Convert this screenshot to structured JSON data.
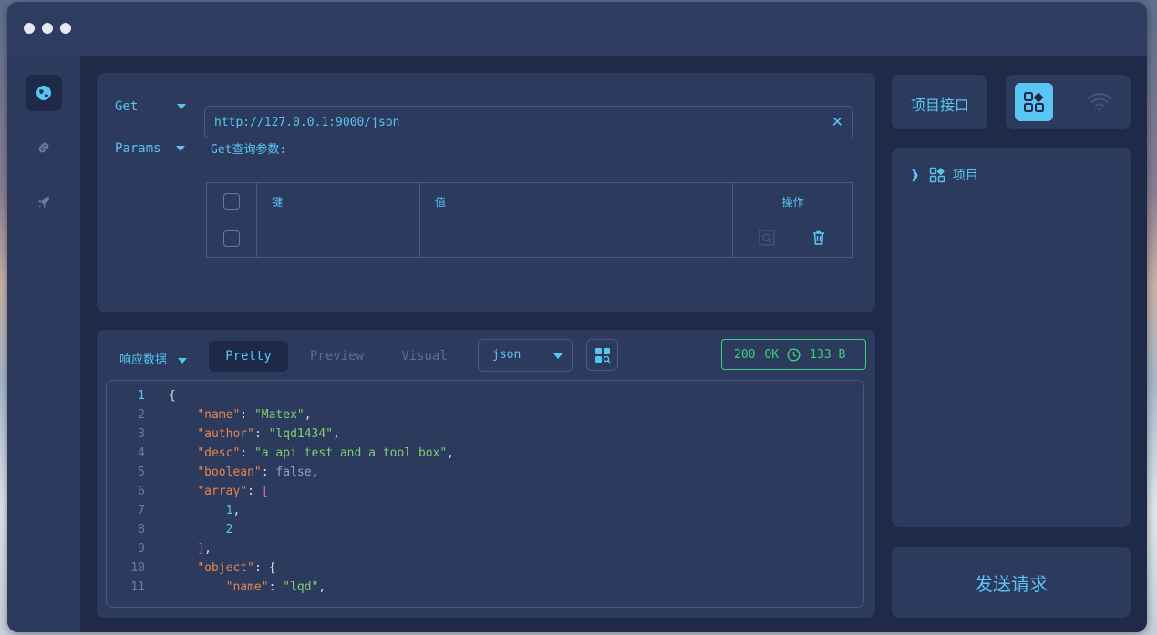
{
  "window": {
    "title_dots": [
      "close",
      "minimize",
      "maximize"
    ]
  },
  "sidebar": {
    "items": [
      {
        "icon": "globe-icon",
        "active": true
      },
      {
        "icon": "link-icon",
        "active": false
      },
      {
        "icon": "rocket-icon",
        "active": false
      }
    ]
  },
  "request": {
    "method": "Get",
    "url": "http://127.0.0.1:9000/json",
    "params_label": "Params",
    "params_title": "Get查询参数:",
    "table": {
      "headers": [
        "键",
        "值",
        "操作"
      ]
    }
  },
  "response": {
    "label": "响应数据",
    "tabs": [
      "Pretty",
      "Preview",
      "Visual"
    ],
    "active_tab": "Pretty",
    "format": "json",
    "status_code": "200",
    "status_text": "OK",
    "size": "133 B",
    "lines": [
      {
        "n": "1"
      },
      {
        "n": "2"
      },
      {
        "n": "3"
      },
      {
        "n": "4"
      },
      {
        "n": "5"
      },
      {
        "n": "6"
      },
      {
        "n": "7"
      },
      {
        "n": "8"
      },
      {
        "n": "9"
      },
      {
        "n": "10"
      },
      {
        "n": "11"
      }
    ],
    "code": {
      "l1": "{",
      "l2k": "\"name\"",
      "l2v": "\"Matex\"",
      "l3k": "\"author\"",
      "l3v": "\"lqd1434\"",
      "l4k": "\"desc\"",
      "l4v": "\"a api test and a tool box\"",
      "l5k": "\"boolean\"",
      "l5v": "false",
      "l6k": "\"array\"",
      "l6v": "[",
      "l7v": "1",
      "l8v": "2",
      "l9v": "]",
      "l10k": "\"object\"",
      "l10v": "{",
      "l11k": "\"name\"",
      "l11v": "\"lqd\""
    }
  },
  "right": {
    "project_tab": "项目接口",
    "tree_item": "项目",
    "send_button": "发送请求"
  },
  "colors": {
    "accent": "#58c5f2",
    "ok": "#3ecf7a",
    "panel": "#2c3a5e",
    "bg": "#1f2a48"
  }
}
